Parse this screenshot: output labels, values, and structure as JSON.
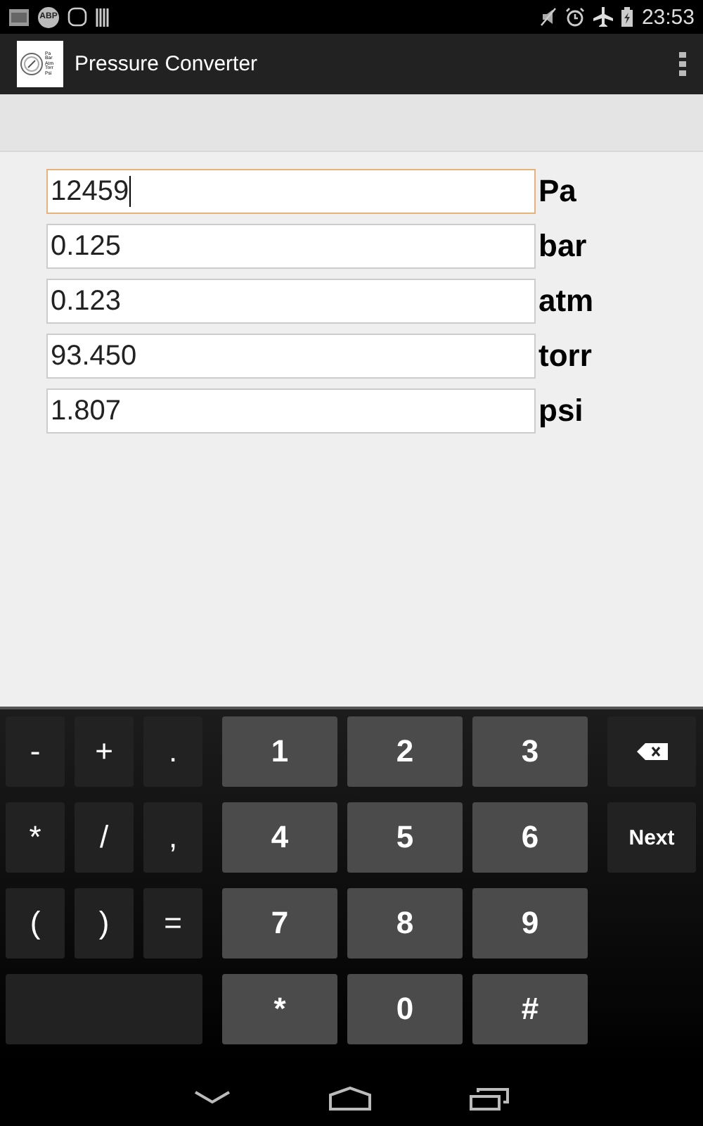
{
  "status_bar": {
    "notification_badge": "ABP",
    "time": "23:53"
  },
  "app_bar": {
    "icon_lines": [
      "Pa",
      "Bar",
      "Atm",
      "Torr",
      "Psi"
    ],
    "title": "Pressure Converter"
  },
  "fields": [
    {
      "value": "12459",
      "unit": "Pa",
      "focused": true
    },
    {
      "value": "0.125",
      "unit": "bar",
      "focused": false
    },
    {
      "value": "0.123",
      "unit": "atm",
      "focused": false
    },
    {
      "value": "93.450",
      "unit": "torr",
      "focused": false
    },
    {
      "value": "1.807",
      "unit": "psi",
      "focused": false
    }
  ],
  "keyboard": {
    "rows": [
      [
        {
          "kind": "symbol",
          "label": "-"
        },
        {
          "kind": "symbol",
          "label": "+"
        },
        {
          "kind": "symbol",
          "label": "."
        },
        {
          "kind": "digit",
          "label": "1"
        },
        {
          "kind": "digit",
          "label": "2"
        },
        {
          "kind": "digit",
          "label": "3"
        },
        {
          "kind": "backspace"
        }
      ],
      [
        {
          "kind": "symbol",
          "label": "*"
        },
        {
          "kind": "symbol",
          "label": "/"
        },
        {
          "kind": "symbol",
          "label": ","
        },
        {
          "kind": "digit",
          "label": "4"
        },
        {
          "kind": "digit",
          "label": "5"
        },
        {
          "kind": "digit",
          "label": "6"
        },
        {
          "kind": "action",
          "label": "Next"
        }
      ],
      [
        {
          "kind": "symbol",
          "label": "("
        },
        {
          "kind": "symbol",
          "label": ")"
        },
        {
          "kind": "symbol",
          "label": "="
        },
        {
          "kind": "digit",
          "label": "7"
        },
        {
          "kind": "digit",
          "label": "8"
        },
        {
          "kind": "digit",
          "label": "9"
        }
      ],
      [
        {
          "kind": "space"
        },
        {
          "kind": "covered"
        },
        {
          "kind": "covered"
        },
        {
          "kind": "digit",
          "label": "*"
        },
        {
          "kind": "digit",
          "label": "0"
        },
        {
          "kind": "digit",
          "label": "#"
        }
      ]
    ]
  }
}
